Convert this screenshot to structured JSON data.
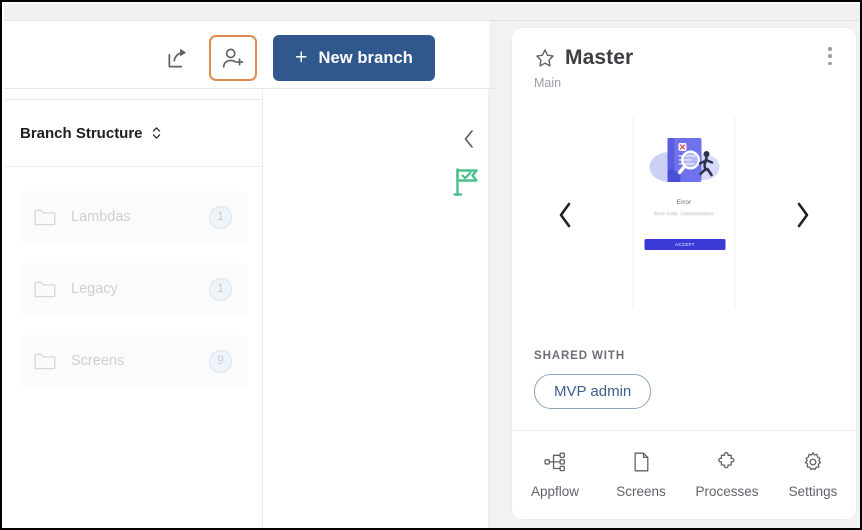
{
  "toolbar": {
    "share_icon": "share-icon",
    "add_user_icon": "add-user-icon",
    "new_branch_plus": "+",
    "new_branch_label": "New branch",
    "highlight_color": "#e08b4c",
    "button_color": "#31588d"
  },
  "branch_structure": {
    "header_label": "Branch Structure",
    "sort_icon": "sort-updown-icon",
    "folders": [
      {
        "icon": "folder-icon",
        "name": "Lambdas",
        "count": "1"
      },
      {
        "icon": "folder-icon",
        "name": "Legacy",
        "count": "1"
      },
      {
        "icon": "folder-icon",
        "name": "Screens",
        "count": "9"
      }
    ]
  },
  "mid": {
    "collapse_icon": "chevron-left-icon",
    "flag_icon": "flag-check-icon",
    "flag_color": "#4cc08a"
  },
  "detail_panel": {
    "star_icon": "star-icon",
    "title": "Master",
    "subtitle": "Main",
    "menu_icon": "kebab-menu-icon",
    "carousel": {
      "prev_icon": "chevron-left-icon",
      "next_icon": "chevron-right-icon",
      "screen": {
        "title": "Error",
        "description": "Error Code: Communication",
        "button_label": "ACCEPT",
        "button_color": "#3b39d8"
      }
    },
    "shared": {
      "label": "SHARED WITH",
      "chips": [
        "MVP admin"
      ]
    },
    "tabs": [
      {
        "icon": "appflow-icon",
        "label": "Appflow"
      },
      {
        "icon": "document-icon",
        "label": "Screens"
      },
      {
        "icon": "puzzle-icon",
        "label": "Processes"
      },
      {
        "icon": "gear-icon",
        "label": "Settings"
      }
    ]
  }
}
